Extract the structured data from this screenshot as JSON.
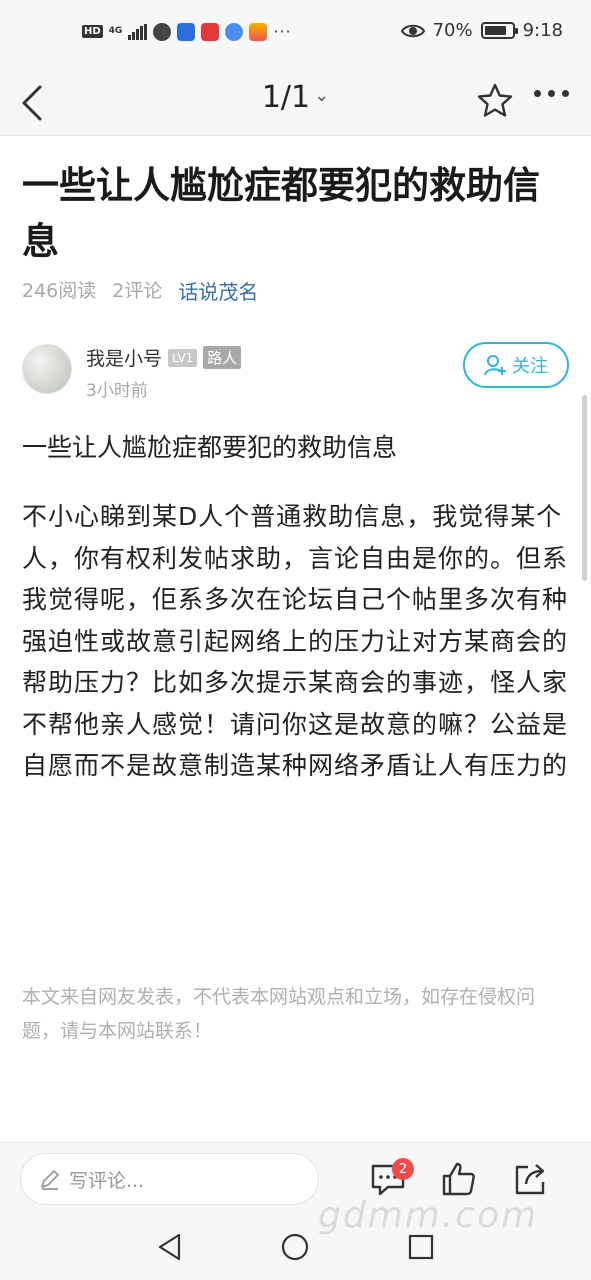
{
  "status_bar": {
    "hd": "HD",
    "network": "4G",
    "more": "···",
    "battery": "70%",
    "time": "9:18"
  },
  "nav": {
    "page_indicator": "1/1",
    "caret": "⌄"
  },
  "article": {
    "title": "一些让人尴尬症都要犯的救助信息",
    "reads": "246阅读",
    "comments": "2评论",
    "channel": "话说茂名"
  },
  "author": {
    "name": "我是小号",
    "level": "LV1",
    "role": "路人",
    "time": "3小时前",
    "follow_label": "关注"
  },
  "content": {
    "heading": "一些让人尴尬症都要犯的救助信息",
    "body": "不小心睇到某D人个普通救助信息，我觉得某个人，你有权利发帖求助，言论自由是你的。但系我觉得呢，佢系多次在论坛自己个帖里多次有种强迫性或故意引起网络上的压力让对方某商会的帮助压力？比如多次提示某商会的事迹，怪人家不帮他亲人感觉！请问你这是故意的嘛？公益是自愿而不是故意制造某种网络矛盾让人有压力的",
    "disclaimer": "本文来自网友发表，不代表本网站观点和立场，如存在侵权问题，请与本网站联系！"
  },
  "comment_bar": {
    "placeholder": "写评论...",
    "comment_count": "2"
  },
  "watermark": "gdmm.com",
  "colors": {
    "accent": "#2fb8d4",
    "channel": "#3a6ea5",
    "badge": "#f04a4a",
    "muted": "#a8a8a8"
  }
}
